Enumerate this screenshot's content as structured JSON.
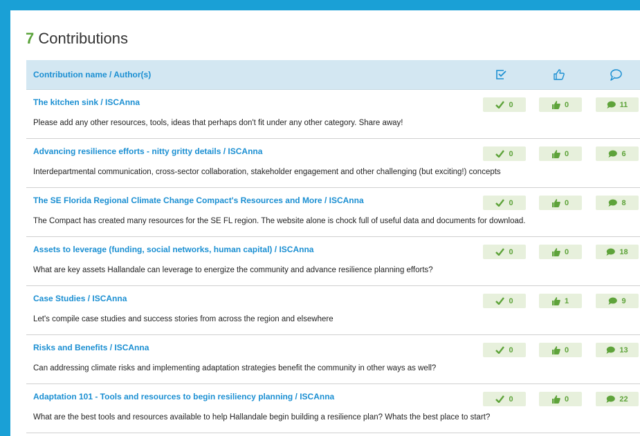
{
  "heading": {
    "count": "7",
    "label": "Contributions"
  },
  "table": {
    "header_label": "Contribution name /  Author(s)",
    "columns": [
      "checklist-icon",
      "thumbs-up-icon",
      "speech-bubble-icon"
    ]
  },
  "separator": " / ",
  "rows": [
    {
      "title": "The kitchen sink",
      "author": "ISCAnna",
      "desc": "Please add any other resources, tools, ideas that perhaps don't fit under any other category. Share away!",
      "checks": "0",
      "likes": "0",
      "comments": "11"
    },
    {
      "title": "Advancing resilience efforts - nitty gritty details",
      "author": "ISCAnna",
      "desc": "Interdepartmental communication, cross-sector collaboration, stakeholder engagement and other challenging (but exciting!) concepts",
      "checks": "0",
      "likes": "0",
      "comments": "6"
    },
    {
      "title": "The SE Florida Regional Climate Change Compact's Resources and More",
      "author": "ISCAnna",
      "desc": "The Compact has created many resources for the SE FL region. The website alone is chock full of useful data and documents for download.",
      "checks": "0",
      "likes": "0",
      "comments": "8"
    },
    {
      "title": "Assets to leverage (funding, social networks, human capital)",
      "author": "ISCAnna",
      "desc": "What are key assets Hallandale can leverage to energize the community and advance resilience planning efforts?",
      "checks": "0",
      "likes": "0",
      "comments": "18"
    },
    {
      "title": "Case Studies",
      "author": "ISCAnna",
      "desc": "Let's compile case studies and success stories from across the region and elsewhere",
      "checks": "0",
      "likes": "1",
      "comments": "9"
    },
    {
      "title": "Risks and Benefits",
      "author": "ISCAnna",
      "desc": "Can addressing climate risks and implementing adaptation strategies benefit the community in other ways as well?",
      "checks": "0",
      "likes": "0",
      "comments": "13"
    },
    {
      "title": "Adaptation 101 - Tools and resources to begin resiliency planning",
      "author": "ISCAnna",
      "desc": "What are the best tools and resources available to help Hallandale begin building a resilience plan? Whats the best place to start?",
      "checks": "0",
      "likes": "0",
      "comments": "22"
    }
  ],
  "colors": {
    "background": "#1aa0d6",
    "link": "#1b8fd2",
    "accent_green": "#5aa33a",
    "badge_bg": "#e7f0dc",
    "header_bg": "#d3e7f2"
  }
}
